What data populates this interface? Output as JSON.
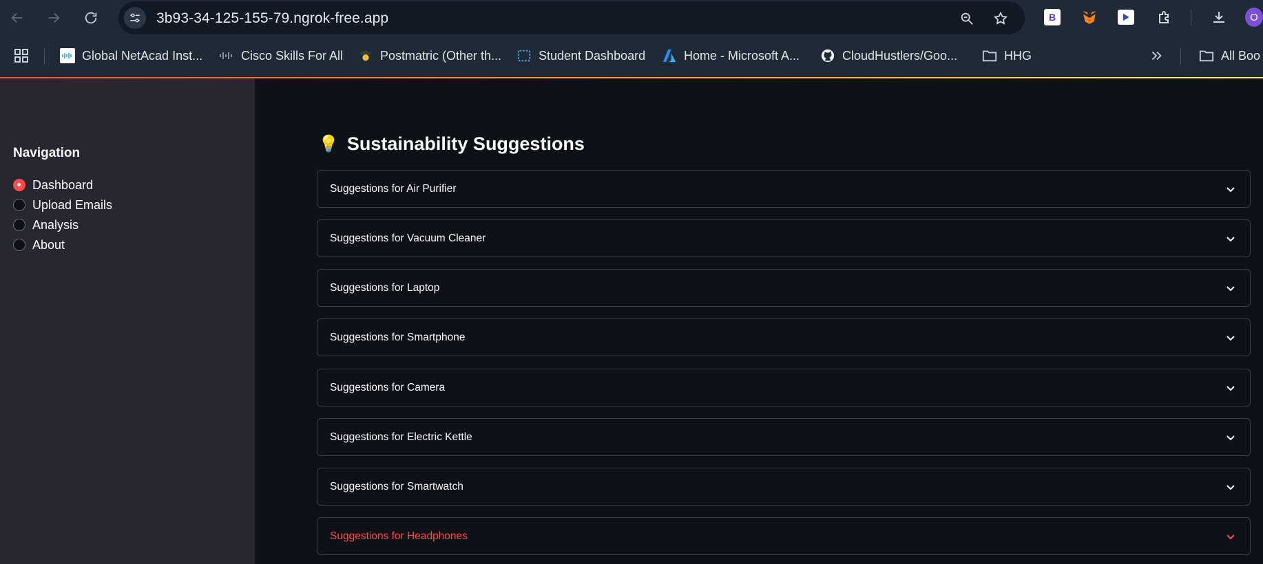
{
  "browser": {
    "url": "3b93-34-125-155-79.ngrok-free.app",
    "profile_initial": "O",
    "extensions": [
      {
        "name": "bootstrap-ext",
        "letter": "B"
      },
      {
        "name": "metamask-fox"
      },
      {
        "name": "media-ext"
      }
    ]
  },
  "bookmarks": [
    {
      "label": "Global NetAcad Inst...",
      "icon": "cisco-icon"
    },
    {
      "label": "Cisco Skills For All",
      "icon": "cisco-icon"
    },
    {
      "label": "Postmatric (Other th...",
      "icon": "graduate-icon"
    },
    {
      "label": "Student Dashboard",
      "icon": "dashboard-icon"
    },
    {
      "label": "Home - Microsoft A...",
      "icon": "azure-icon"
    },
    {
      "label": "CloudHustlers/Goo...",
      "icon": "github-icon"
    },
    {
      "label": "HHG",
      "icon": "folder-icon"
    }
  ],
  "all_bookmarks": "All Boo",
  "sidebar": {
    "title": "Navigation",
    "options": [
      {
        "label": "Dashboard",
        "selected": true
      },
      {
        "label": "Upload Emails",
        "selected": false
      },
      {
        "label": "Analysis",
        "selected": false
      },
      {
        "label": "About",
        "selected": false
      }
    ]
  },
  "main": {
    "heading_emoji": "💡",
    "heading": "Sustainability Suggestions",
    "expanders": [
      {
        "label": "Suggestions for Air Purifier"
      },
      {
        "label": "Suggestions for Vacuum Cleaner"
      },
      {
        "label": "Suggestions for Laptop"
      },
      {
        "label": "Suggestions for Smartphone"
      },
      {
        "label": "Suggestions for Camera"
      },
      {
        "label": "Suggestions for Electric Kettle"
      },
      {
        "label": "Suggestions for Smartwatch"
      },
      {
        "label": "Suggestions for Headphones",
        "hovered": true
      }
    ]
  },
  "colors": {
    "accent": "#ff4b4b",
    "sidebar_bg": "#262730",
    "main_bg": "#0e1117"
  }
}
